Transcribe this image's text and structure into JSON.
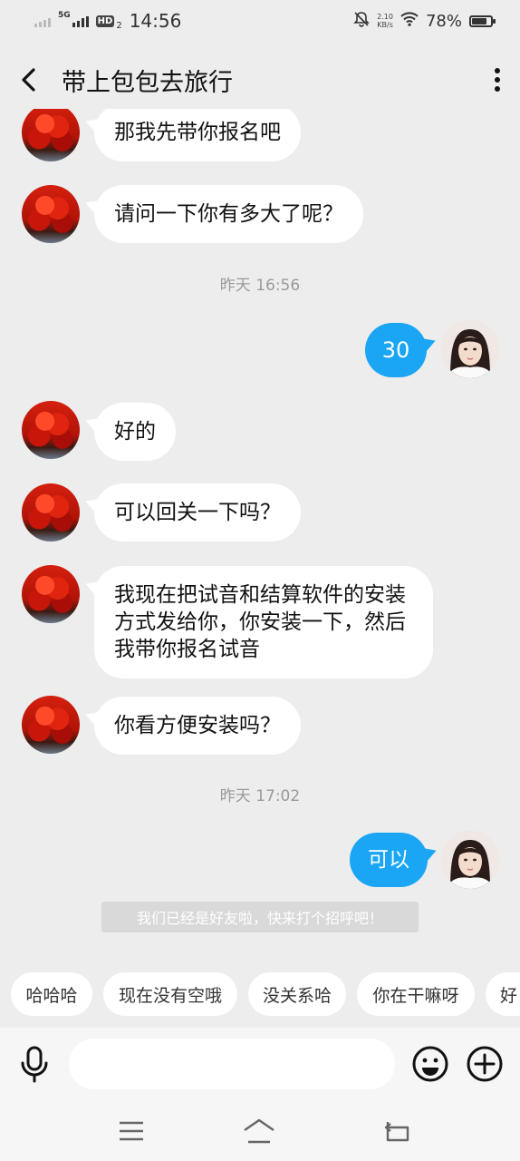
{
  "status_bar": {
    "network_tag": "5G",
    "hd_label": "HD",
    "hd_sub": "2",
    "time": "14:56",
    "net_speed_value": "2.10",
    "net_speed_unit": "KB/s",
    "battery_percent": "78%",
    "battery_level": 0.78
  },
  "header": {
    "title": "带上包包去旅行",
    "back_icon": "chevron-left-icon",
    "more_icon": "more-vertical-icon"
  },
  "messages": [
    {
      "side": "left",
      "text": "那我先带你报名吧"
    },
    {
      "side": "left",
      "text": "请问一下你有多大了呢？"
    },
    {
      "type": "time",
      "text": "昨天 16:56"
    },
    {
      "side": "right",
      "text": "30"
    },
    {
      "side": "left",
      "text": "好的"
    },
    {
      "side": "left",
      "text": "可以回关一下吗？"
    },
    {
      "side": "left",
      "text": "我现在把试音和结算软件的安装\n方式发给你，你安装一下，然后\n我带你报名试音"
    },
    {
      "side": "left",
      "text": "你看方便安装吗？"
    },
    {
      "type": "time",
      "text": "昨天 17:02"
    },
    {
      "side": "right",
      "text": "可以"
    },
    {
      "type": "system",
      "text": "我们已经是好友啦，快来打个招呼吧！"
    }
  ],
  "quick_replies": [
    "哈哈哈",
    "现在没有空哦",
    "没关系哈",
    "你在干嘛呀",
    "好"
  ],
  "input_bar": {
    "placeholder": "",
    "mic_icon": "microphone-icon",
    "emoji_icon": "smiley-icon",
    "plus_icon": "plus-circle-icon"
  },
  "nav_bar": {
    "icons": [
      "menu-icon",
      "home-icon",
      "back-icon"
    ]
  },
  "colors": {
    "background": "#ededed",
    "sent_bubble": "#1aa6f5",
    "received_bubble": "#ffffff"
  }
}
